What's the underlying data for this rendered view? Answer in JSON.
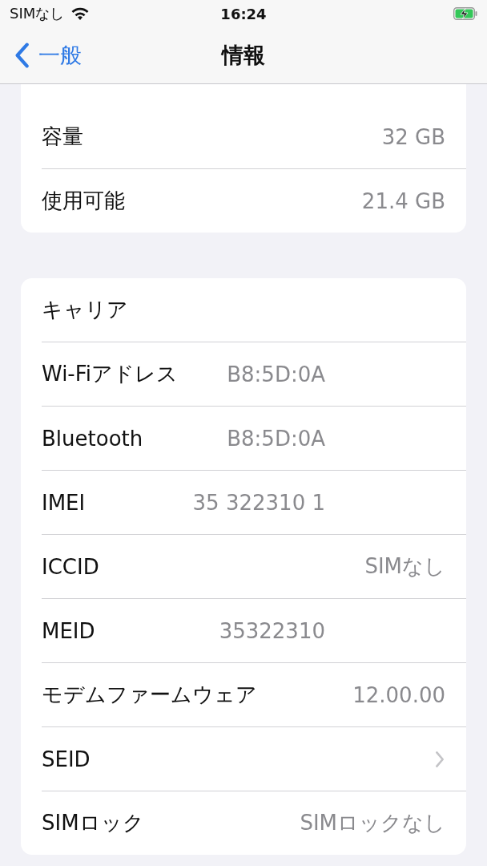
{
  "status_bar": {
    "carrier": "SIMなし",
    "time": "16:24",
    "charging": true
  },
  "nav": {
    "back": "一般",
    "title": "情報"
  },
  "groups": [
    {
      "rows": [
        {
          "kind": "plain",
          "label": "容量",
          "value": "32 GB"
        },
        {
          "kind": "plain",
          "label": "使用可能",
          "value": "21.4 GB"
        }
      ]
    },
    {
      "rows": [
        {
          "kind": "masked",
          "label": "キャリア"
        },
        {
          "kind": "masked",
          "label": "Wi-Fiアドレス",
          "value": "B8:5D:0A"
        },
        {
          "kind": "masked",
          "label": "Bluetooth",
          "value": "B8:5D:0A"
        },
        {
          "kind": "masked",
          "label": "IMEI",
          "value": "35 322310 1"
        },
        {
          "kind": "plain",
          "label": "ICCID",
          "value": "SIMなし"
        },
        {
          "kind": "masked",
          "label": "MEID",
          "value": "35322310"
        },
        {
          "kind": "plain",
          "label": "モデムファームウェア",
          "value": "12.00.00"
        },
        {
          "kind": "link",
          "label": "SEID"
        },
        {
          "kind": "plain",
          "label": "SIMロック",
          "value": "SIMロックなし"
        }
      ]
    }
  ]
}
